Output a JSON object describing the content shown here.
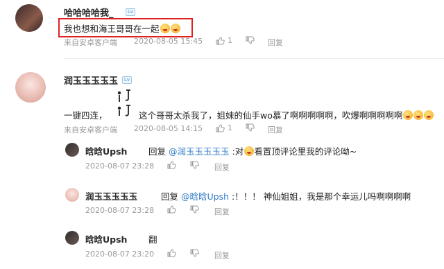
{
  "comments": [
    {
      "username": "哈哈哈哈我_",
      "text": "我也想和海王哥哥在一起",
      "source": "来自安卓客户端",
      "time": "2020-08-05 15:45",
      "likes": "1",
      "reply_label": "回复"
    },
    {
      "username": "润玉玉玉玉玉",
      "text_part1": "一键四连，",
      "text_part2": "这个哥哥太杀我了，姐妹的仙手wo慕了啊啊啊啊啊，吹爆啊啊啊啊啊",
      "source": "来自安卓客户端",
      "time": "2020-08-05 14:15",
      "likes": "1",
      "reply_label": "回复"
    }
  ],
  "replies": [
    {
      "username": "晗晗Upsh",
      "reply_word": "回复",
      "mention": "@润玉玉玉玉玉",
      "text_before_emoji": ":对",
      "text_after_emoji": "看置顶评论里我的评论呦~",
      "time": "2020-08-07 23:28",
      "reply_label": "回复"
    },
    {
      "username": "润玉玉玉玉玉",
      "reply_word": "回复",
      "mention": "@晗晗Upsh",
      "text": ":！！！ 神仙姐姐，我是那个幸运儿吗啊啊啊啊",
      "time": "2020-08-07 23:28",
      "reply_label": "回复"
    },
    {
      "username": "晗晗Upsh",
      "text": "翻",
      "time": "2020-08-07 23:20",
      "reply_label": "回复"
    }
  ],
  "icons": [
    "badge-icon",
    "thumbs-up-icon",
    "thumbs-down-icon",
    "emoji-icon",
    "avatar"
  ],
  "colors": {
    "link": "#2f79c5",
    "highlight_border": "#e02020",
    "meta": "#9a9a9a"
  }
}
